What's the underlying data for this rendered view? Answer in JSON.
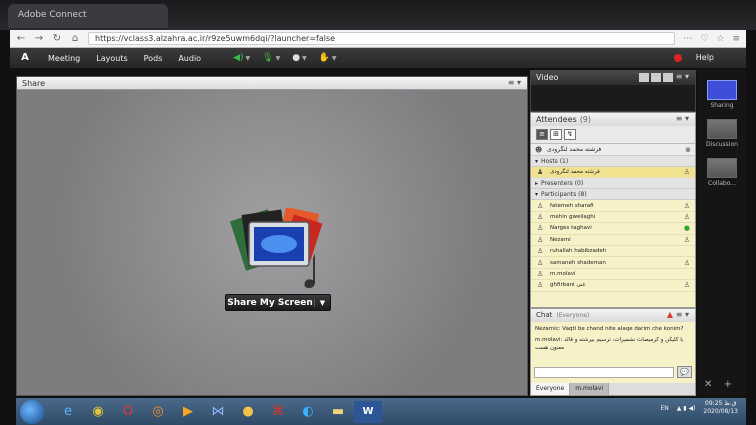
{
  "browser": {
    "tab_title": "Adobe Connect",
    "url": "https://vclass3.alzahra.ac.ir/r9ze5uwm6dqi/?launcher=false"
  },
  "menubar": {
    "items": [
      "Meeting",
      "Layouts",
      "Pods",
      "Audio"
    ],
    "help": "Help"
  },
  "share_pod": {
    "title": "Share",
    "button_label": "Share My Screen"
  },
  "video_pod": {
    "title": "Video"
  },
  "attendees_pod": {
    "title": "Attendees",
    "count": "(9)",
    "me_name": "فرشته محمد لنگرودی",
    "hosts_label": "Hosts (1)",
    "host_name": "فرشته محمد لنگرودی",
    "presenters_label": "Presenters (0)",
    "participants_label": "Participants (8)",
    "participants": [
      {
        "name": "fatemeh sharafi",
        "status": "grey"
      },
      {
        "name": "mehin gweilaghi",
        "status": "grey"
      },
      {
        "name": "Narges taghavi",
        "status": "green"
      },
      {
        "name": "Nezami",
        "status": "grey"
      },
      {
        "name": "ruhallah habibzadeh",
        "status": ""
      },
      {
        "name": "samaneh shademan",
        "status": "grey"
      },
      {
        "name": "m.molavi",
        "status": ""
      },
      {
        "name": "ghfirbani غنی",
        "status": "grey"
      }
    ]
  },
  "chat_pod": {
    "title": "Chat",
    "scope": "(Everyone)",
    "messages": [
      "Nezamic: Vaqti be chand nite alaqe darim che konim?",
      "m.molavi: با کلیکن و کرمیصات نشمیرات، ترسیم بیرشته و قالد معنون هست"
    ],
    "tab_everyone": "Everyone",
    "tab_private": "m.molavi"
  },
  "layouts_panel": {
    "items": [
      "Sharing",
      "Discussion",
      "Collabo..."
    ]
  },
  "taskbar": {
    "lang": "EN",
    "time": "09:25 ق.ظ",
    "date": "2020/08/13"
  }
}
